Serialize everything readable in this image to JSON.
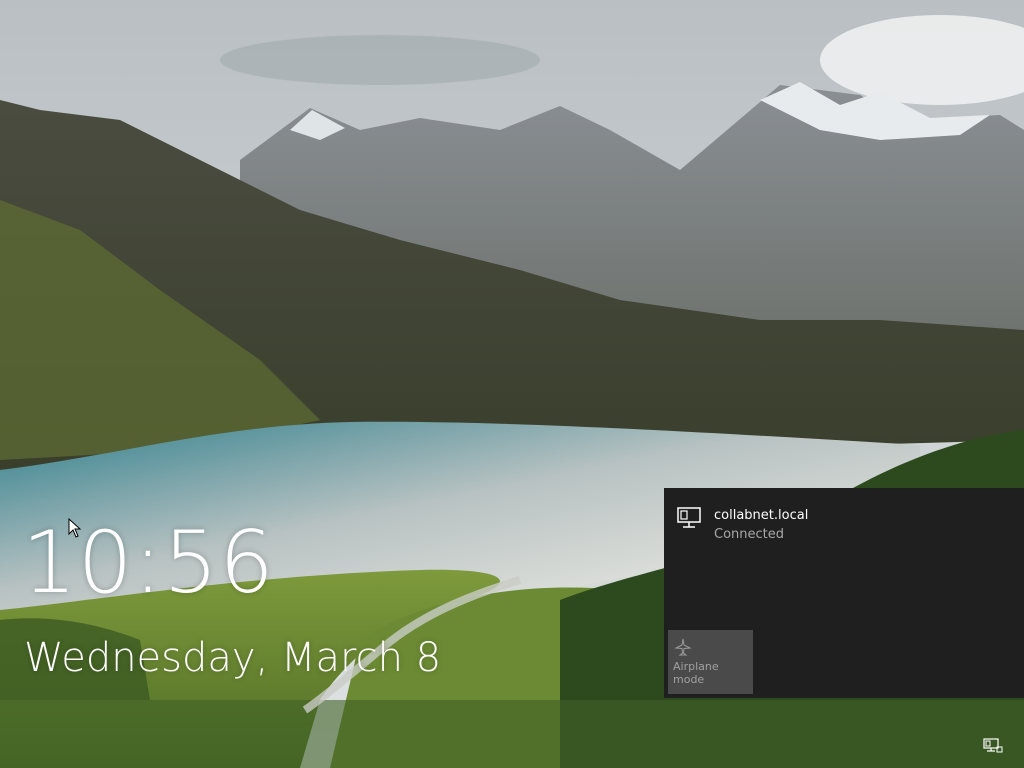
{
  "lock_screen": {
    "time": "10:56",
    "date": "Wednesday, March 8"
  },
  "network_flyout": {
    "network": {
      "name": "collabnet.local",
      "status": "Connected",
      "icon": "wired-network-icon"
    },
    "airplane_mode": {
      "label": "Airplane mode",
      "icon": "airplane-icon",
      "enabled": false
    }
  },
  "tray": {
    "network_icon": "network-status-icon"
  },
  "colors": {
    "flyout_bg": "#1f1f1f",
    "tile_bg": "#4a4a4a",
    "secondary_text": "#a8a8a8"
  }
}
